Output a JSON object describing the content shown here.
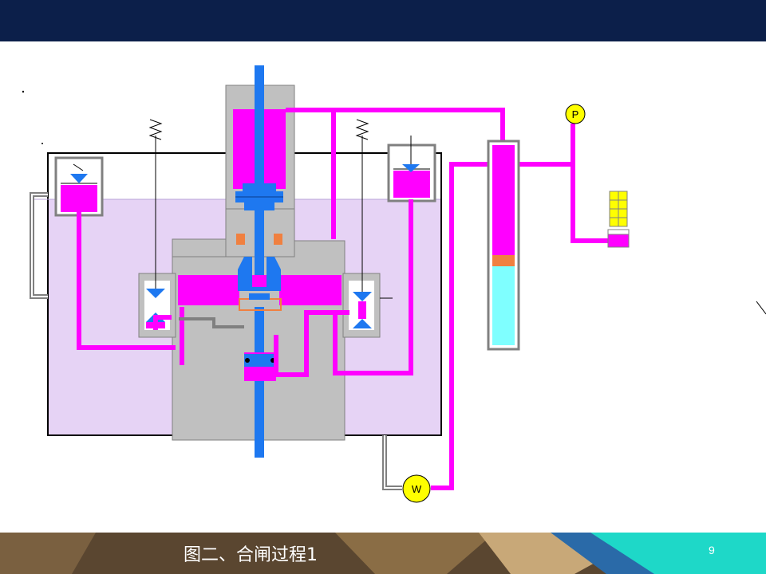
{
  "caption": "图二、合闸过程1",
  "page_number": "9",
  "gauge_labels": {
    "pressure": "P",
    "pump": "W"
  },
  "colors": {
    "banner": "#0c1f4a",
    "oil_tank": "#e6d3f5",
    "housing": "#c0c0c0",
    "pressure_oil": "#ff00ff",
    "piston_rod": "#1e78f0",
    "accumulator_gas": "#7fffff",
    "seal": "#f08040",
    "gauge": "#ffff00"
  }
}
